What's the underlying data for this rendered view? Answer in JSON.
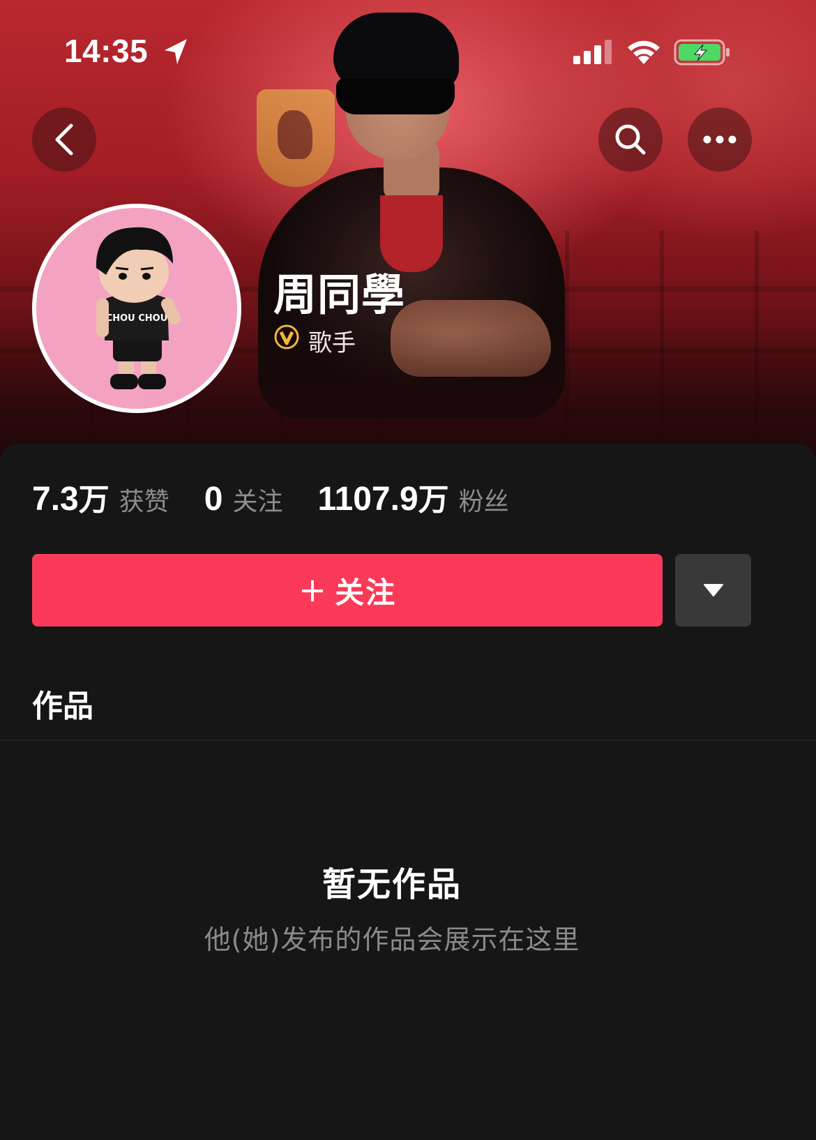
{
  "status_bar": {
    "time": "14:35",
    "icons": [
      "location-arrow-icon",
      "cellular-signal-icon",
      "wifi-icon",
      "battery-charging-icon"
    ],
    "battery_color": "#4cd964"
  },
  "nav": {
    "back_icon": "chevron-left-icon",
    "search_icon": "search-icon",
    "more_icon": "more-dots-icon"
  },
  "profile": {
    "name": "周同學",
    "verify_icon": "verified-v-badge-icon",
    "verify_label": "歌手",
    "avatar_text": "CHOU CHOU"
  },
  "stats": [
    {
      "num": "7.3",
      "unit": "万",
      "label": "获赞"
    },
    {
      "num": "0",
      "unit": "",
      "label": "关注"
    },
    {
      "num": "1107.9",
      "unit": "万",
      "label": "粉丝"
    }
  ],
  "actions": {
    "follow_plus": "+",
    "follow_label": "关注",
    "dropdown_icon": "triangle-down-icon",
    "accent_color": "#fb3a59"
  },
  "tabs": {
    "works": "作品"
  },
  "empty_state": {
    "title": "暂无作品",
    "subtitle": "他(她)发布的作品会展示在这里"
  }
}
